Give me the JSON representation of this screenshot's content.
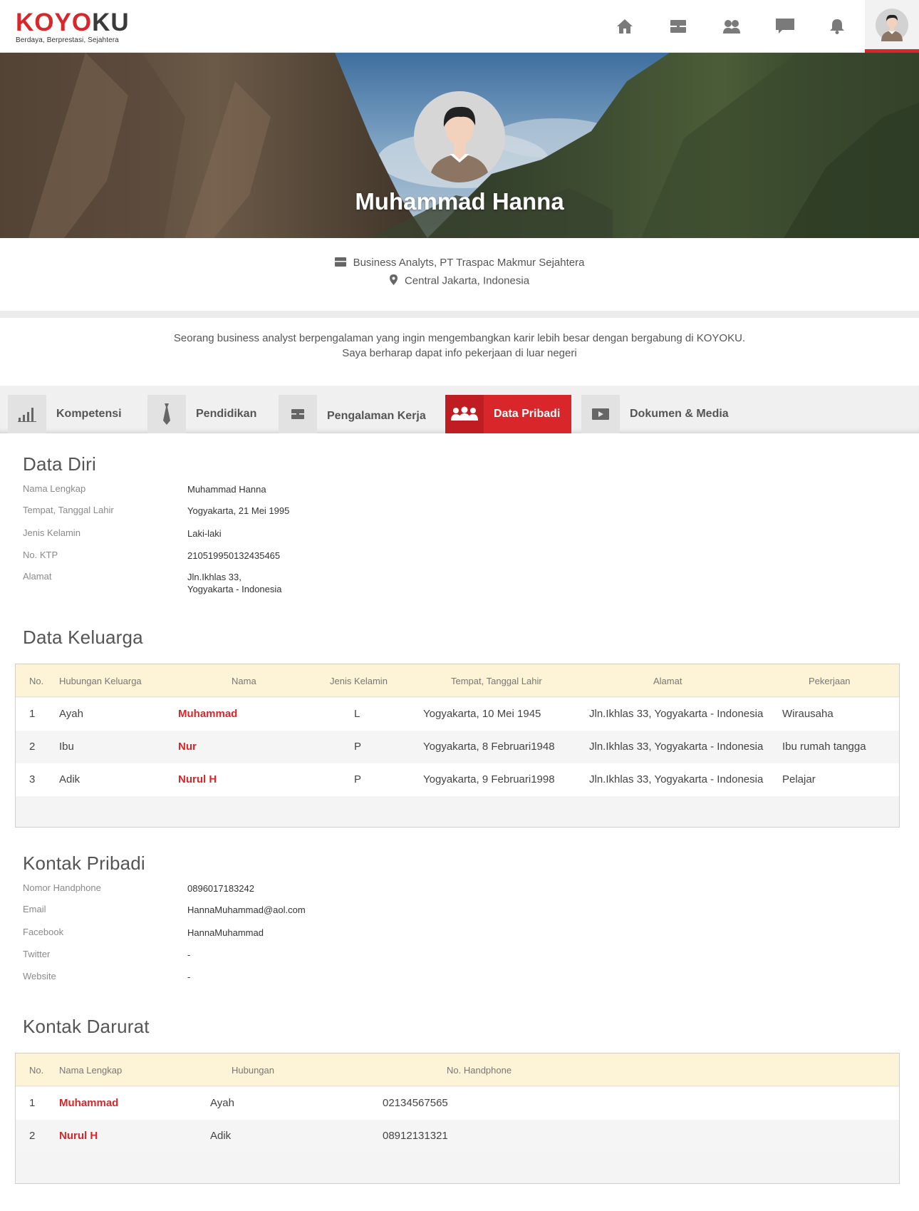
{
  "brand": {
    "name_part1": "KOYO",
    "name_part2": "KU",
    "tagline": "Berdaya, Berprestasi, Sejahtera"
  },
  "nav": {
    "icons": [
      "home-icon",
      "briefcase-icon",
      "people-icon",
      "chat-icon",
      "bell-icon"
    ]
  },
  "profile": {
    "name": "Muhammad Hanna",
    "job": "Business Analyts,  PT Traspac Makmur Sejahtera",
    "location": "Central Jakarta, Indonesia",
    "bio_line1": "Seorang business  analyst berpengalaman yang ingin mengembangkan karir lebih besar dengan bergabung di KOYOKU.",
    "bio_line2": "Saya berharap dapat info pekerjaan di luar negeri"
  },
  "tabs": [
    {
      "label": "Kompetensi",
      "icon": "bar-chart-icon",
      "active": false
    },
    {
      "label": "Pendidikan",
      "icon": "tie-icon",
      "active": false
    },
    {
      "label": "Pengalaman Kerja",
      "icon": "briefcase-icon",
      "active": false
    },
    {
      "label": "Data Pribadi",
      "icon": "family-icon",
      "active": true
    },
    {
      "label": "Dokumen & Media",
      "icon": "play-icon",
      "active": false
    }
  ],
  "data_diri": {
    "title": "Data Diri",
    "rows": [
      {
        "label": "Nama Lengkap",
        "value": "Muhammad Hanna"
      },
      {
        "label": "Tempat, Tanggal Lahir",
        "value": "Yogyakarta, 21 Mei 1995"
      },
      {
        "label": "Jenis Kelamin",
        "value": "Laki-laki"
      },
      {
        "label": "No. KTP",
        "value": "210519950132435465"
      },
      {
        "label": "Alamat",
        "value": "Jln.Ikhlas 33,",
        "value2": "Yogyakarta - Indonesia"
      }
    ]
  },
  "data_keluarga": {
    "title": "Data Keluarga",
    "headers": [
      "No.",
      "Hubungan Keluarga",
      "Nama",
      "Jenis Kelamin",
      "Tempat, Tanggal Lahir",
      "Alamat",
      "Pekerjaan"
    ],
    "rows": [
      [
        "1",
        "Ayah",
        "Muhammad",
        "L",
        "Yogyakarta, 10 Mei 1945",
        "Jln.Ikhlas 33, Yogyakarta - Indonesia",
        "Wirausaha"
      ],
      [
        "2",
        "Ibu",
        "Nur",
        "P",
        "Yogyakarta, 8 Februari1948",
        "Jln.Ikhlas 33, Yogyakarta - Indonesia",
        "Ibu rumah tangga"
      ],
      [
        "3",
        "Adik",
        "Nurul H",
        "P",
        "Yogyakarta, 9 Februari1998",
        "Jln.Ikhlas 33, Yogyakarta - Indonesia",
        "Pelajar"
      ]
    ]
  },
  "kontak_pribadi": {
    "title": "Kontak Pribadi",
    "rows": [
      {
        "label": "Nomor Handphone",
        "value": "0896017183242"
      },
      {
        "label": "Email",
        "value": "HannaMuhammad@aol.com"
      },
      {
        "label": "Facebook",
        "value": "HannaMuhammad"
      },
      {
        "label": "Twitter",
        "value": "-"
      },
      {
        "label": "Website",
        "value": "-"
      }
    ]
  },
  "kontak_darurat": {
    "title": "Kontak Darurat",
    "headers": [
      "No.",
      "Nama Lengkap",
      "Hubungan",
      "No. Handphone"
    ],
    "rows": [
      [
        "1",
        "Muhammad",
        "Ayah",
        "02134567565"
      ],
      [
        "2",
        "Nurul H",
        "Adik",
        "08912131321"
      ]
    ]
  },
  "colors": {
    "accent": "#d9262b",
    "table_header": "#fdf3d6"
  }
}
